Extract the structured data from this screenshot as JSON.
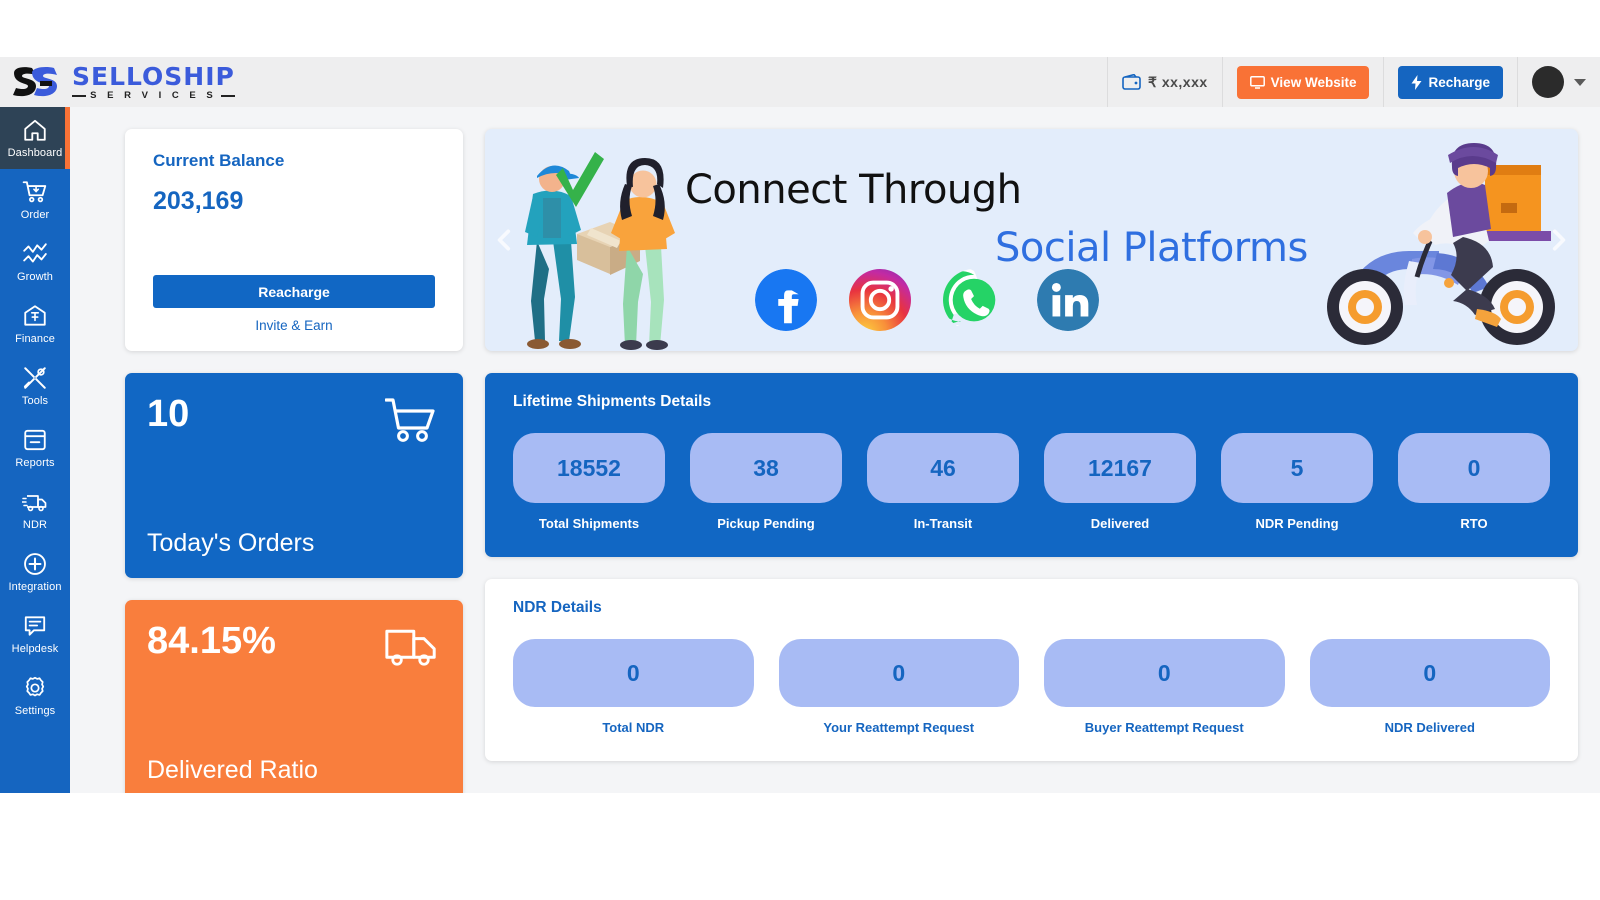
{
  "header": {
    "logo_word": "SELLOSHIP",
    "logo_sub": "S E R V I C E S",
    "wallet_amount": "₹ xx,xxx",
    "view_website_label": "View Website",
    "recharge_label": "Recharge"
  },
  "sidebar": {
    "items": [
      {
        "label": "Dashboard",
        "icon": "home-icon",
        "active": true
      },
      {
        "label": "Order",
        "icon": "cart-icon",
        "active": false
      },
      {
        "label": "Growth",
        "icon": "growth-icon",
        "active": false
      },
      {
        "label": "Finance",
        "icon": "finance-icon",
        "active": false
      },
      {
        "label": "Tools",
        "icon": "tools-icon",
        "active": false
      },
      {
        "label": "Reports",
        "icon": "reports-icon",
        "active": false
      },
      {
        "label": "NDR",
        "icon": "truck-icon",
        "active": false
      },
      {
        "label": "Integration",
        "icon": "plus-circle-icon",
        "active": false
      },
      {
        "label": "Helpdesk",
        "icon": "chat-icon",
        "active": false
      },
      {
        "label": "Settings",
        "icon": "gear-icon",
        "active": false
      }
    ]
  },
  "balance": {
    "title": "Current Balance",
    "amount": "203,169",
    "recharge_label": "Reacharge",
    "invite_label": "Invite & Earn"
  },
  "banner": {
    "line1": "Connect Through",
    "line2": "Social Platforms",
    "socials": [
      "facebook-icon",
      "instagram-icon",
      "whatsapp-icon",
      "linkedin-icon"
    ]
  },
  "tiles": [
    {
      "value": "10",
      "label": "Today's Orders",
      "icon": "cart-icon",
      "color": "#1167c4"
    },
    {
      "value": "84.15%",
      "label": "Delivered Ratio",
      "icon": "truck-icon",
      "color": "#f97e3d"
    }
  ],
  "lifetime": {
    "title": "Lifetime Shipments Details",
    "stats": [
      {
        "value": "18552",
        "label": "Total Shipments"
      },
      {
        "value": "38",
        "label": "Pickup Pending"
      },
      {
        "value": "46",
        "label": "In-Transit"
      },
      {
        "value": "12167",
        "label": "Delivered"
      },
      {
        "value": "5",
        "label": "NDR Pending"
      },
      {
        "value": "0",
        "label": "RTO"
      }
    ]
  },
  "ndr": {
    "title": "NDR Details",
    "stats": [
      {
        "value": "0",
        "label": "Total NDR"
      },
      {
        "value": "0",
        "label": "Your Reattempt Request"
      },
      {
        "value": "0",
        "label": "Buyer Reattempt Request"
      },
      {
        "value": "0",
        "label": "NDR Delivered"
      }
    ]
  },
  "colors": {
    "primary_blue": "#1565c0",
    "tile_blue": "#1167c4",
    "accent_orange": "#f97e3d",
    "pill_bg": "#a8bbf4",
    "sidebar_active": "#2e4356"
  }
}
